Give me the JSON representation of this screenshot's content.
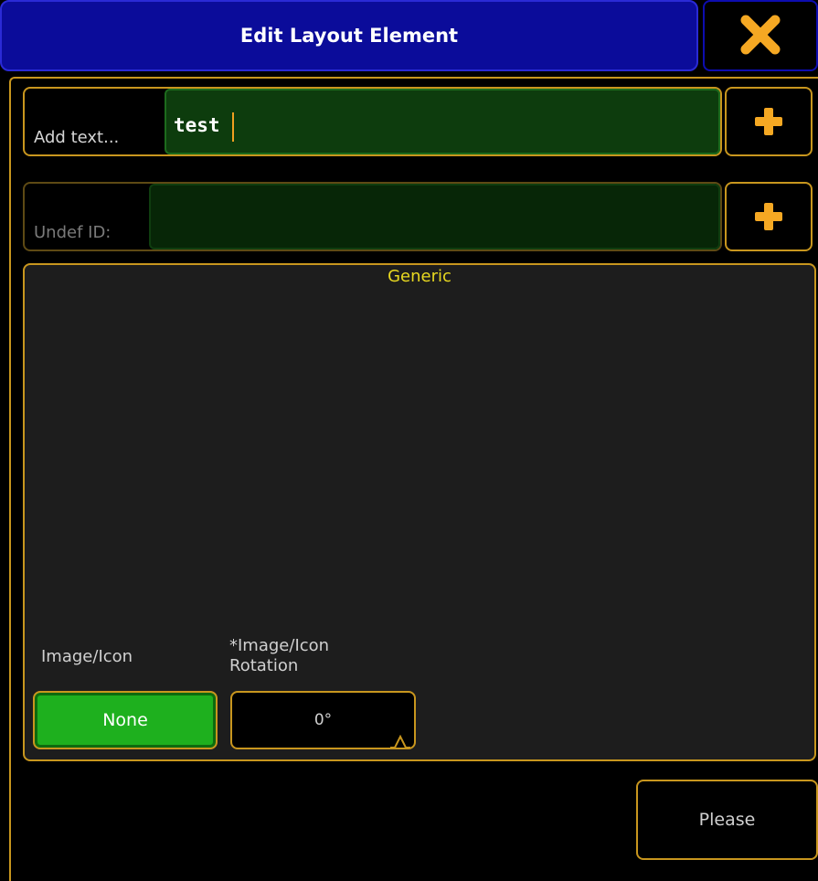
{
  "window": {
    "title": "Edit Layout Element",
    "close_icon": "close-icon",
    "accent_color": "#c8961e",
    "title_bar_color": "#0b0c9a"
  },
  "text_row": {
    "label": "Add text...",
    "value": "test",
    "add_icon": "plus-icon"
  },
  "id_row": {
    "label": "Undef ID:",
    "value": "",
    "add_icon": "plus-icon"
  },
  "generic_section": {
    "title": "Generic",
    "image_icon": {
      "label": "Image/Icon",
      "value": "None"
    },
    "rotation": {
      "label_line1": "*Image/Icon",
      "label_line2": "Rotation",
      "value": "0°"
    }
  },
  "footer": {
    "please_label": "Please"
  }
}
